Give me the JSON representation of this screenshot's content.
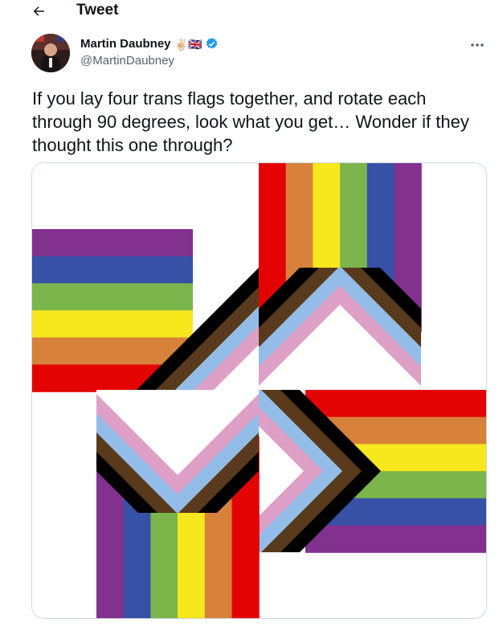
{
  "header": {
    "title": "Tweet",
    "back_icon": "arrow-left-icon"
  },
  "author": {
    "display_name": "Martin Daubney",
    "emoji": "✌🏻🇬🇧",
    "handle": "@MartinDaubney",
    "verified": true,
    "verified_color": "#1d9bf0"
  },
  "tweet": {
    "text": "If you lay four trans flags together, and rotate each through 90 degrees, look what you get… Wonder if they thought this one through?"
  },
  "media": {
    "stripe_colors": [
      "#e40303",
      "#d8813a",
      "#f7e81e",
      "#7bb54b",
      "#3651a6",
      "#82318f"
    ],
    "chevron_colors": [
      "#000000",
      "#5a3a1c",
      "#93bde8",
      "#dea0c6",
      "#ffffff"
    ]
  }
}
